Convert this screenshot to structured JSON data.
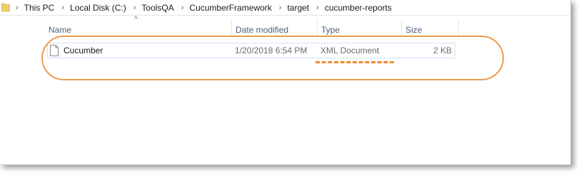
{
  "breadcrumb": {
    "items": [
      "This PC",
      "Local Disk (C:)",
      "ToolsQA",
      "CucumberFramework",
      "target",
      "cucumber-reports"
    ]
  },
  "columns": {
    "name": "Name",
    "date_modified": "Date modified",
    "type": "Type",
    "size": "Size"
  },
  "files": [
    {
      "name": "Cucumber",
      "date_modified": "1/20/2018 6:54 PM",
      "type": "XML Document",
      "size": "2 KB"
    }
  ],
  "icons": {
    "folder": "folder-icon",
    "file": "file-icon",
    "sort": "sort-ascending-icon"
  },
  "colors": {
    "annotation": "#ee9a4c",
    "header_text": "#4c607a",
    "row_border": "#cfe3f7"
  }
}
